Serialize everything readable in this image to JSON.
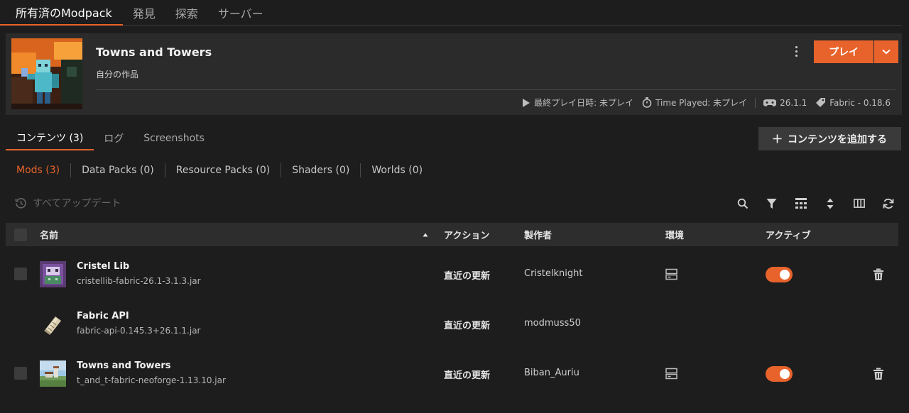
{
  "top_tabs": [
    {
      "label": "所有済のModpack"
    },
    {
      "label": "発見"
    },
    {
      "label": "探索"
    },
    {
      "label": "サーバー"
    }
  ],
  "instance": {
    "title": "Towns and Towers",
    "subtitle": "自分の作品",
    "play_label": "プレイ",
    "last_played": "最終プレイ日時: 未プレイ",
    "time_played": "Time Played: 未プレイ",
    "game_version": "26.1.1",
    "loader": "Fabric - 0.18.6"
  },
  "content_tabs": [
    {
      "label": "コンテンツ (3)"
    },
    {
      "label": "ログ"
    },
    {
      "label": "Screenshots"
    }
  ],
  "add_content_label": "コンテンツを追加する",
  "filters": [
    {
      "label": "Mods (3)"
    },
    {
      "label": "Data Packs (0)"
    },
    {
      "label": "Resource Packs (0)"
    },
    {
      "label": "Shaders (0)"
    },
    {
      "label": "Worlds (0)"
    }
  ],
  "update_all_label": "すべてアップデート",
  "table": {
    "headers": {
      "name": "名前",
      "action": "アクション",
      "author": "製作者",
      "environment": "環境",
      "active": "アクティブ"
    },
    "rows": [
      {
        "name": "Cristel Lib",
        "file": "cristellib-fabric-26.1-3.1.3.jar",
        "action": "直近の更新",
        "author": "Cristelknight"
      },
      {
        "name": "Fabric API",
        "file": "fabric-api-0.145.3+26.1.1.jar",
        "action": "直近の更新",
        "author": "modmuss50"
      },
      {
        "name": "Towns and Towers",
        "file": "t_and_t-fabric-neoforge-1.13.10.jar",
        "action": "直近の更新",
        "author": "Biban_Auriu"
      }
    ]
  },
  "colors": {
    "accent": "#e8632b",
    "background": "#1d1d1d",
    "panel": "#2b2b2b"
  },
  "icons": [
    "play-icon",
    "stopwatch-icon",
    "controller-icon",
    "tag-icon",
    "plus-icon",
    "refresh-clock-icon",
    "search-icon",
    "filter-icon",
    "grid-icon",
    "sort-icon",
    "columns-icon",
    "refresh-icon",
    "server-icon",
    "trash-icon",
    "chevron-down-icon",
    "kebab-icon"
  ]
}
